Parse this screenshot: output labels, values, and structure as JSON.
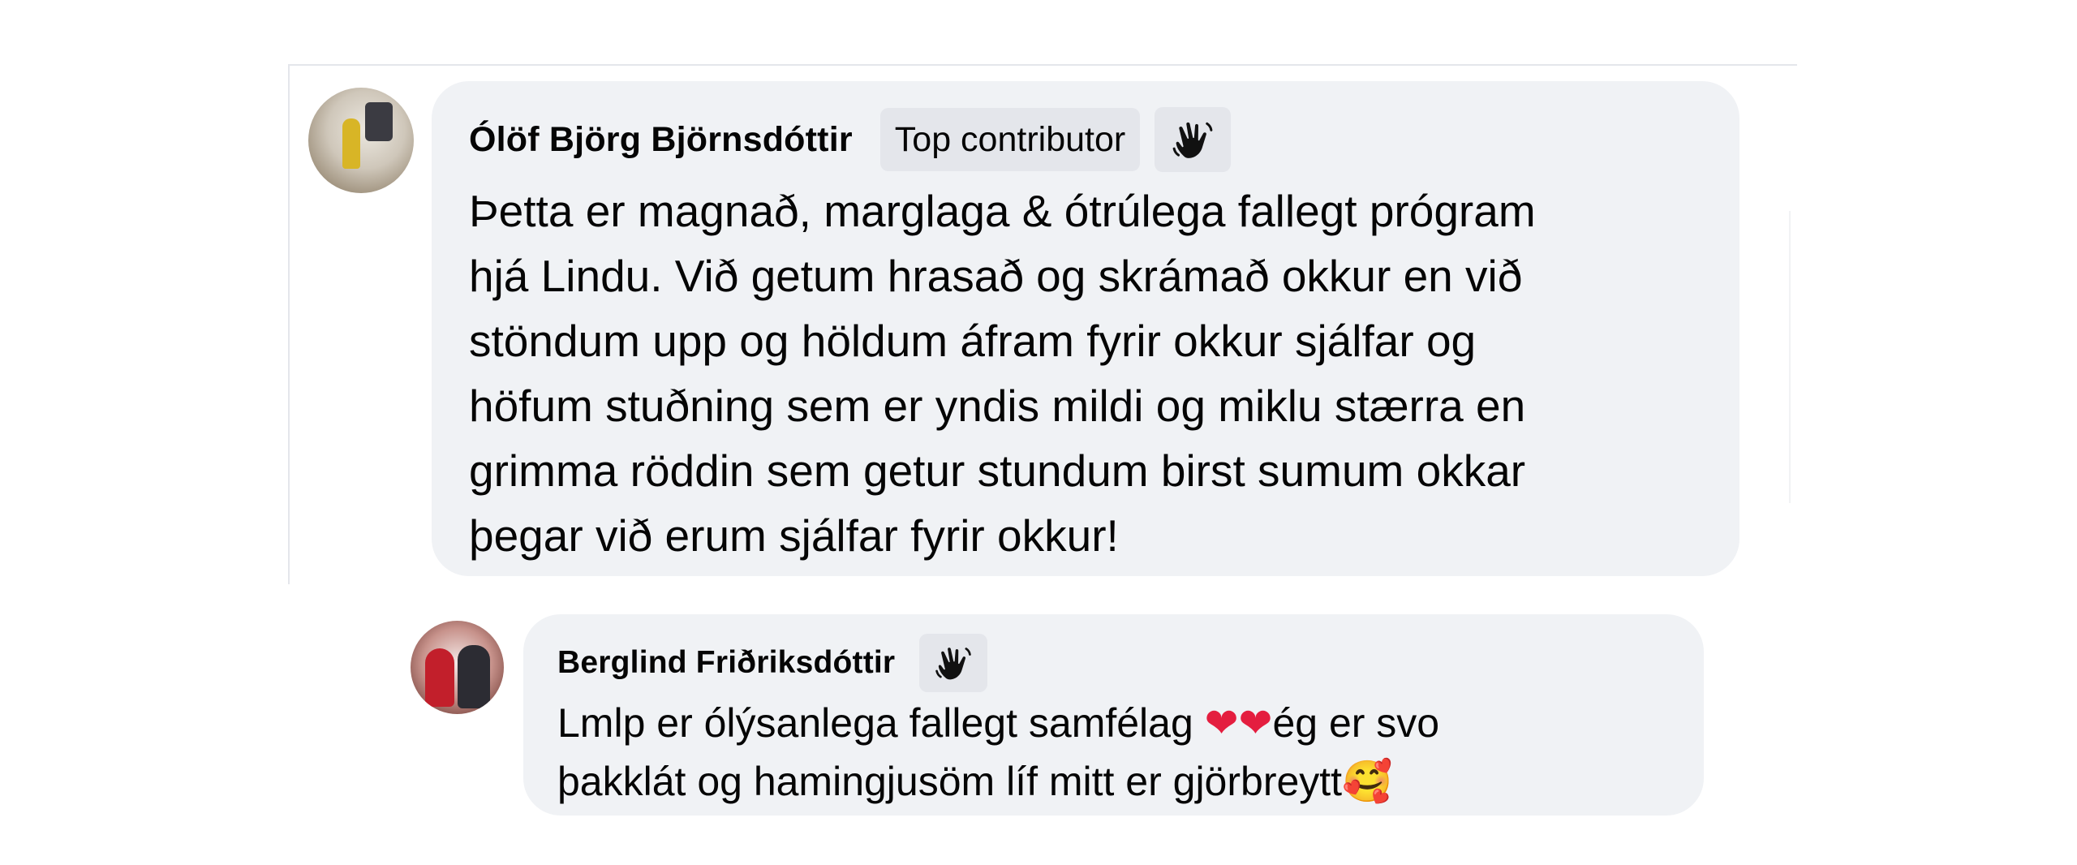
{
  "comments": [
    {
      "author": "Ólöf Björg Björnsdóttir",
      "badge": "Top contributor",
      "badge_icon": "wave-hand-icon",
      "lines": [
        "Þetta er magnað, marglaga & ótrúlega fallegt prógram",
        "hjá Lindu. Við getum hrasað og skrámað okkur en við",
        "stöndum upp og höldum áfram fyrir okkur sjálfar og",
        "höfum stuðning sem er yndis mildi og miklu stærra en",
        "grimma röddin sem getur stundum birst sumum okkar",
        "þegar við erum sjálfar fyrir okkur!"
      ]
    },
    {
      "author": "Berglind Friðriksdóttir",
      "badge_icon": "wave-hand-icon",
      "line1_text": "Lmlp er ólýsanlega fallegt samfélag ",
      "line1_emoji": "❤❤",
      "line1_tail": "ég er svo",
      "line2_text": "þakklát og hamingjusöm líf mitt er gjörbreytt",
      "line2_emoji": "🥰"
    }
  ],
  "colors": {
    "bubble_bg": "#f0f2f5",
    "badge_bg": "#e4e6eb",
    "text": "#050505",
    "heart": "#e41e3f"
  }
}
